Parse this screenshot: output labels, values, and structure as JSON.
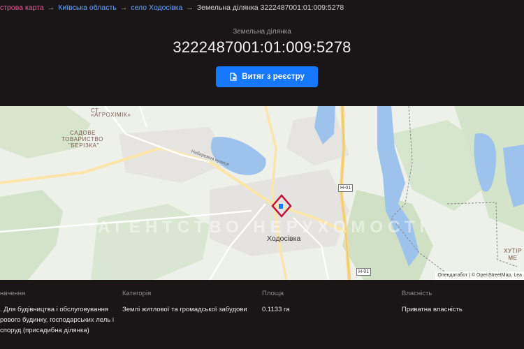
{
  "breadcrumb": {
    "items": [
      {
        "label": "строва карта",
        "style": "pink"
      },
      {
        "label": "Київська область",
        "style": "blue"
      },
      {
        "label": "село Ходосівка",
        "style": "blue"
      }
    ],
    "current": "Земельна ділянка 3222487001:01:009:5278",
    "separator": "→"
  },
  "hero": {
    "subtitle": "Земельна ділянка",
    "title": "3222487001:01:009:5278",
    "button_label": "Витяг з реєстру"
  },
  "map": {
    "labels": {
      "agro_1": "СТ",
      "agro_2": "«АГРОХІМІК»",
      "sadove_1": "САДОВЕ",
      "sadove_2": "ТОВАРИСТВО",
      "sadove_3": "\"БЕРІЗКА\"",
      "street": "Набережна вулиця",
      "city": "Ходосівка",
      "khutir": "ХУТІР МЕ",
      "road_1": "Н-01",
      "road_2": "Н-01"
    },
    "watermark": "АГЕНТСТВО НЕРУХОМОСТІ",
    "attribution": "Опендатабот | © OpenStreetMap, Lea"
  },
  "details": {
    "purpose": {
      "label": "начення",
      "value": ". Для будівництва і обслуговування рового будинку, господарських лель і споруд (присадибна ділянка)"
    },
    "category": {
      "label": "Категорія",
      "value": "Землі житлової та громадської забудови"
    },
    "area": {
      "label": "Площа",
      "value": "0.1133 га"
    },
    "ownership": {
      "label": "Власність",
      "value": "Приватна власність"
    }
  },
  "colors": {
    "accent": "#1677ff",
    "pink_link": "#e85a9b",
    "blue_link": "#6aa6ff",
    "parcel_marker": "#c0143c"
  }
}
